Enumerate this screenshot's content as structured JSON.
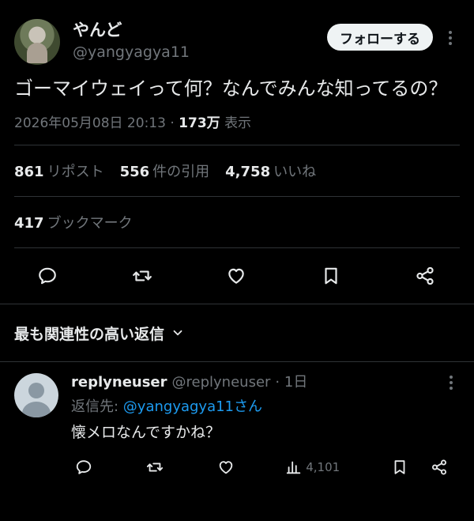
{
  "post": {
    "author": {
      "display_name": "やんど",
      "handle": "@yangyagya11"
    },
    "follow_label": "フォローする",
    "text": "ゴーマイウェイって何？なんでみんな知ってるの？",
    "timestamp": "2026年05月08日 20:13",
    "views_separator": "·",
    "views_count": "173万",
    "views_label": "表示",
    "stats": {
      "reposts": {
        "count": "861",
        "label": "リポスト"
      },
      "quotes": {
        "count": "556",
        "label": "件の引用"
      },
      "likes": {
        "count": "4,758",
        "label": "いいね"
      },
      "bookmarks": {
        "count": "417",
        "label": "ブックマーク"
      }
    }
  },
  "replies_sort": {
    "label": "最も関連性の高い返信"
  },
  "reply": {
    "display_name": "replyneuser",
    "handle": "@replyneuser",
    "time": "· 1日",
    "reply_to_prefix": "返信先: ",
    "reply_to_mention": "@yangyagya11さん",
    "text": "懐メロなんですかね？",
    "views": "4,101"
  },
  "icons": {
    "reply": "speech-bubble-icon",
    "repost": "repost-arrows-icon",
    "like": "heart-icon",
    "bookmark": "bookmark-icon",
    "share": "share-icon",
    "views": "bar-chart-icon"
  },
  "colors": {
    "background": "#000000",
    "text": "#e7e9ea",
    "muted": "#71767b",
    "link": "#1d9bf0",
    "divider": "#2f3336"
  }
}
